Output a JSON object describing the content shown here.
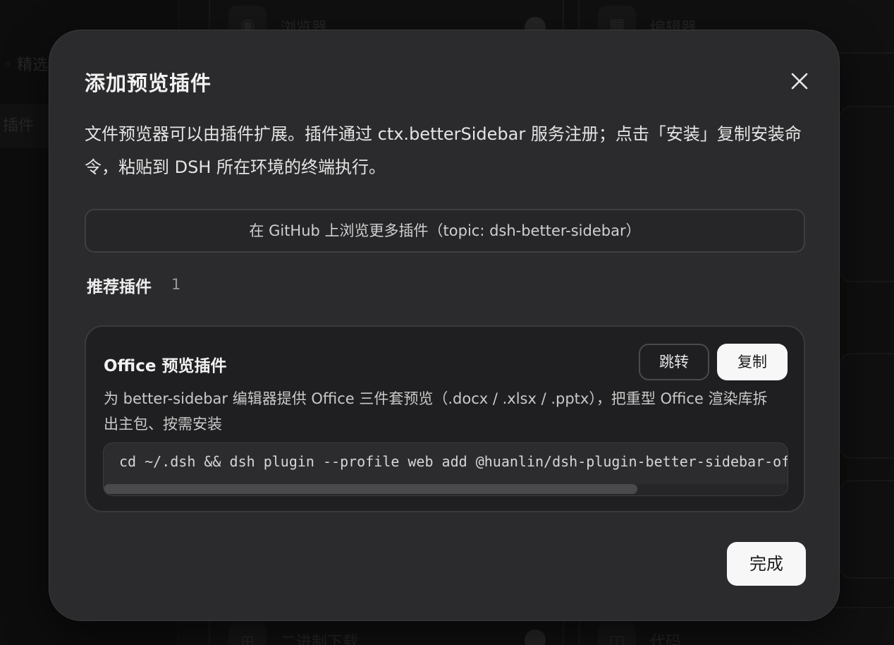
{
  "background": {
    "sidebar_items": [
      "◦ 精选",
      "插件"
    ],
    "cards": [
      {
        "title": "浏览器",
        "icon": "◉"
      },
      {
        "title": "编辑器",
        "icon": "▦"
      },
      {
        "title": "二进制下载",
        "icon": "⊞"
      },
      {
        "title": "代码",
        "icon": "◫"
      }
    ]
  },
  "modal": {
    "title": "添加预览插件",
    "description": "文件预览器可以由插件扩展。插件通过 ctx.betterSidebar 服务注册；点击「安装」复制安装命令，粘贴到 DSH 所在环境的终端执行。",
    "github_button": "在 GitHub 上浏览更多插件（topic: dsh-better-sidebar）",
    "recommended": {
      "heading": "推荐插件",
      "count": "1"
    },
    "plugin": {
      "name": "Office 预览插件",
      "jump_label": "跳转",
      "copy_label": "复制",
      "description": "为 better-sidebar 编辑器提供 Office 三件套预览（.docx / .xlsx / .pptx），把重型 Office 渲染库拆出主包、按需安装",
      "command": "cd ~/.dsh && dsh plugin --profile web add @huanlin/dsh-plugin-better-sidebar-office",
      "scroll_fraction": 0.78
    },
    "done_label": "完成"
  },
  "colors": {
    "modal_bg": "#2b2b2d",
    "card_bg": "#1f1f21",
    "primary_button_bg": "#f7f7f8"
  }
}
